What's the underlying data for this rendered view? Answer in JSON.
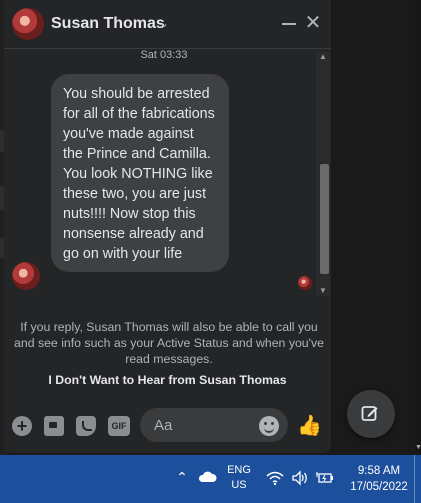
{
  "chat": {
    "header": {
      "name": "Susan Thomas"
    },
    "timestamp": "Sat 03:33",
    "message": "You should be arrested for all of the fabrications you've made against the Prince and Camilla. You look NOTHING like these two, you are just nuts!!!! Now stop this nonsense already and go on with your life",
    "notice": "If you reply, Susan Thomas will also be able to call you and see info such as your Active Status and when you've read messages.",
    "block_link": "I Don't Want to Hear from Susan Thomas",
    "composer": {
      "placeholder": "Aa"
    }
  },
  "taskbar": {
    "lang_line1": "ENG",
    "lang_line2": "US",
    "time": "9:58 AM",
    "date": "17/05/2022"
  },
  "colors": {
    "chat_bg": "#242526",
    "bubble_bg": "#3e4042",
    "taskbar_bg": "#1c4f9c",
    "text_primary": "#e4e6eb",
    "text_secondary": "#b0b3b8"
  }
}
